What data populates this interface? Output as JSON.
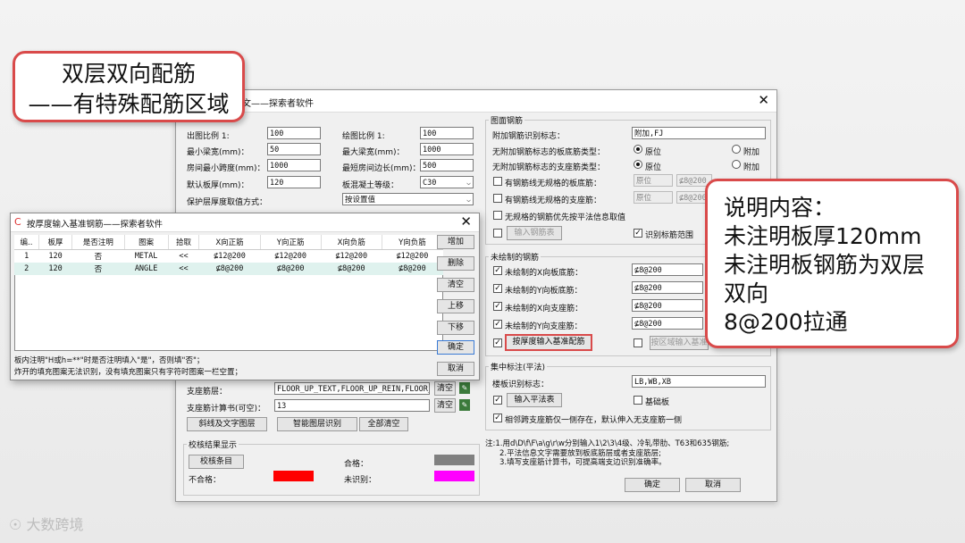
{
  "callout1": {
    "line1": "双层双向配筋",
    "line2": "——有特殊配筋区域"
  },
  "callout2": {
    "line1": "说明内容：",
    "line2": "未注明板厚120mm",
    "line3": "未注明板钢筋为双层",
    "line4": "双向",
    "line5": "8@200拉通"
  },
  "main": {
    "title": "文——探索者软件",
    "left": {
      "ratio_out_label": "出图比例 1:",
      "ratio_out": "100",
      "ratio_draw_label": "绘图比例 1:",
      "ratio_draw": "100",
      "min_beam_label": "最小梁宽(mm)：",
      "min_beam": "50",
      "max_beam_label": "最大梁宽(mm)：",
      "max_beam": "1000",
      "min_span_label": "房间最小跨度(mm)：",
      "min_span": "1000",
      "min_edge_label": "最短房间边长(mm)：",
      "min_edge": "500",
      "default_thick_label": "默认板厚(mm)：",
      "default_thick": "120",
      "concrete_label": "板混凝土等级：",
      "concrete": "C30",
      "cover_label": "保护层厚度取值方式：",
      "cover": "按设置值",
      "support_layer_label": "支座筋层：",
      "support_layer": "FLOOR_UP_TEXT,FLOOR_UP_REIN,FLOOR_",
      "support_calc_label": "支座筋计算书(可空)：",
      "support_calc": "13",
      "clear1": "清空",
      "clear2": "清空",
      "btn_diag": "斜线及文字图层",
      "btn_smart": "智能图层识别",
      "btn_clearall": "全部清空",
      "check_group": "校核结果显示",
      "btn_check": "校核条目",
      "qualified": "合格：",
      "unqualified": "不合格：",
      "unrecognized": "未识别：",
      "color_qualified": "#808080",
      "color_unqualified": "#ff0000",
      "color_unrecognized": "#ff00ff"
    },
    "right": {
      "group1": "图面钢筋",
      "attach_label": "附加钢筋识别标志：",
      "attach": "附加,FJ",
      "bottom_type_label": "无附加钢筋标志的板底筋类型：",
      "support_type_label": "无附加钢筋标志的支座筋类型：",
      "opt_orig": "原位",
      "opt_attach": "附加",
      "irregular_bottom": "有钢筋线无规格的板底筋：",
      "irregular_support": "有钢筋线无规格的支座筋：",
      "irr_sel": "原位",
      "irr_val": "⊈8@200",
      "no_spec_plane": "无规格的钢筋优先按平法信息取值",
      "btn_input_rebar": "输入钢筋表",
      "recog_range": "识别标筋范围",
      "group2": "未绘制的钢筋",
      "x_bottom": "未绘制的X向板底筋：",
      "y_bottom": "未绘制的Y向板底筋：",
      "x_support": "未绘制的X向支座筋：",
      "y_support": "未绘制的Y向支座筋：",
      "val": "⊈8@200",
      "btn_thick_base": "按厚度输入基准配筋",
      "btn_region_base": "按区域输入基准",
      "group3": "集中标注(平法)",
      "slab_mark_label": "楼板识别标志：",
      "slab_mark": "LB,WB,XB",
      "btn_input_plane": "输入平法表",
      "base_slab": "基础板",
      "adjacent": "相邻跨支座筋仅一侧存在，默认伸入无支座筋一侧",
      "note1": "注:1.用d\\D\\f\\F\\a\\g\\r\\w分别输入1\\2\\3\\4级、冷轧带肋、T63和635钢筋;",
      "note2": "2.平法信息文字需要放到板底筋层或者支座筋层;",
      "note3": "3.填写支座筋计算书，可提高端支边识别准确率。",
      "ok": "确定",
      "cancel": "取消"
    }
  },
  "sub": {
    "title": "按厚度输入基准钢筋——探索者软件",
    "headers": [
      "编..",
      "板厚",
      "是否注明",
      "图案",
      "拾取",
      "X向正筋",
      "Y向正筋",
      "X向负筋",
      "Y向负筋"
    ],
    "rows": [
      [
        "1",
        "120",
        "否",
        "METAL",
        "<<",
        "⊈12@200",
        "⊈12@200",
        "⊈12@200",
        "⊈12@200"
      ],
      [
        "2",
        "120",
        "否",
        "ANGLE",
        "<<",
        "⊈8@200",
        "⊈8@200",
        "⊈8@200",
        "⊈8@200"
      ]
    ],
    "buttons": [
      "增加",
      "删除",
      "清空",
      "上移",
      "下移",
      "确定",
      "取消"
    ],
    "note1": "板内注明\"H或h=**\"时是否注明填入\"是\"，否则填\"否\"；",
    "note2": "炸开的填充图案无法识别，没有填充图案只有字符时图案一栏空置；"
  },
  "watermark": "大数跨境"
}
